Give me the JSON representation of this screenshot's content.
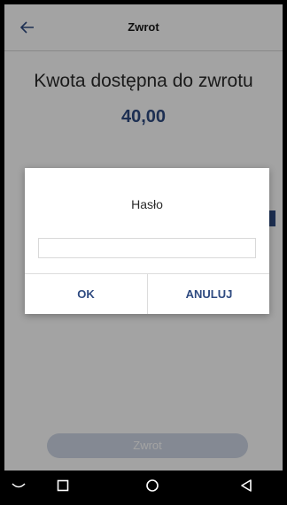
{
  "header": {
    "title": "Zwrot",
    "back_icon": "arrow-left-icon"
  },
  "main": {
    "available_label": "Kwota dostępna do zwrotu",
    "available_amount": "40,00",
    "refund_button_label": "Zwrot"
  },
  "dialog": {
    "title": "Hasło",
    "password_value": "",
    "ok_label": "OK",
    "cancel_label": "ANULUJ"
  },
  "nav_bar": {
    "icons": [
      "hide-keyboard-icon",
      "recents-icon",
      "home-icon",
      "back-triangle-icon"
    ]
  },
  "colors": {
    "accent": "#2e4a80",
    "disabled_button": "#cfd7e6",
    "overlay": "rgba(0,0,0,0.36)"
  }
}
